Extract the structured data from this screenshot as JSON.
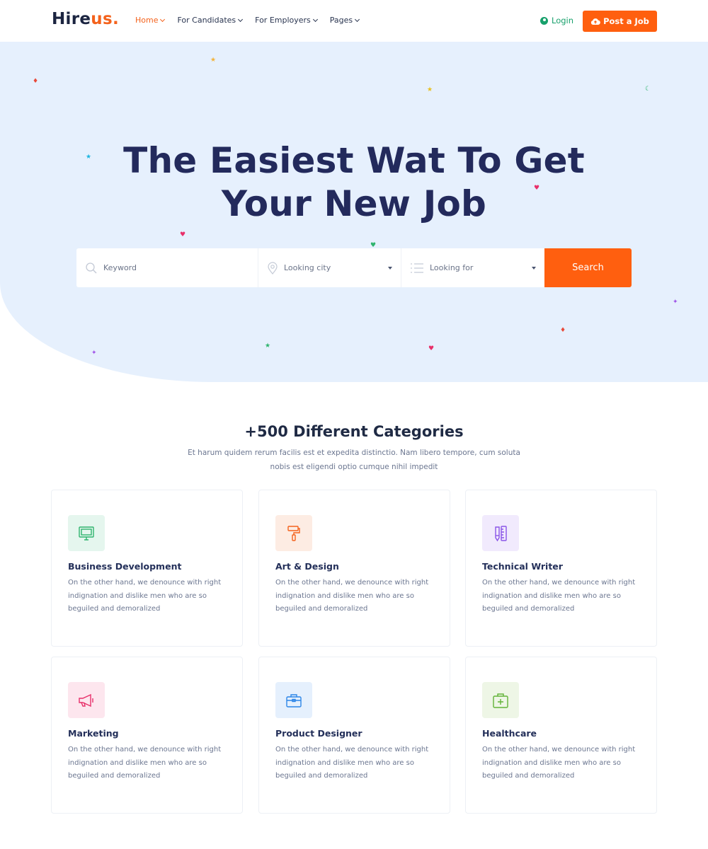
{
  "header": {
    "logo_main": "Hire",
    "logo_accent": "us.",
    "nav": [
      {
        "label": "Home",
        "active": true
      },
      {
        "label": "For Candidates",
        "active": false
      },
      {
        "label": "For Employers",
        "active": false
      },
      {
        "label": "Pages",
        "active": false
      }
    ],
    "login_label": "Login",
    "post_job_label": "Post a Job"
  },
  "hero": {
    "title_line1": "The Easiest Wat To Get",
    "title_line2": "Your New Job",
    "search": {
      "keyword_placeholder": "Keyword",
      "city_placeholder": "Looking city",
      "looking_for_placeholder": "Looking for",
      "button_label": "Search"
    }
  },
  "categories": {
    "title": "+500 Different Categories",
    "subtitle": "Et harum quidem rerum facilis est et expedita distinctio. Nam libero tempore, cum soluta nobis est eligendi optio cumque nihil impedit",
    "items": [
      {
        "name": "Business Development",
        "desc": "On the other hand, we denounce with right indignation and dislike men who are so beguiled and demoralized",
        "icon": "monitor-icon",
        "color": "#2fb46e",
        "bg": "#e5f6ee"
      },
      {
        "name": "Art & Design",
        "desc": "On the other hand, we denounce with right indignation and dislike men who are so beguiled and demoralized",
        "icon": "paint-roller-icon",
        "color": "#f4621c",
        "bg": "#fdece3"
      },
      {
        "name": "Technical Writer",
        "desc": "On the other hand, we denounce with right indignation and dislike men who are so beguiled and demoralized",
        "icon": "pencil-ruler-icon",
        "color": "#8a55e8",
        "bg": "#f1eafd"
      },
      {
        "name": "Marketing",
        "desc": "On the other hand, we denounce with right indignation and dislike men who are so beguiled and demoralized",
        "icon": "megaphone-icon",
        "color": "#e8306a",
        "bg": "#fde6ee"
      },
      {
        "name": "Product Designer",
        "desc": "On the other hand, we denounce with right indignation and dislike men who are so beguiled and demoralized",
        "icon": "briefcase-icon",
        "color": "#2d86e8",
        "bg": "#e5f0fd"
      },
      {
        "name": "Healthcare",
        "desc": "On the other hand, we denounce with right indignation and dislike men who are so beguiled and demoralized",
        "icon": "medical-bag-icon",
        "color": "#62b338",
        "bg": "#eef6e6"
      }
    ]
  },
  "colors": {
    "accent": "#ff5f0f",
    "heading": "#232a5c",
    "hero_bg": "#e6f0fd",
    "login": "#17a06b"
  }
}
